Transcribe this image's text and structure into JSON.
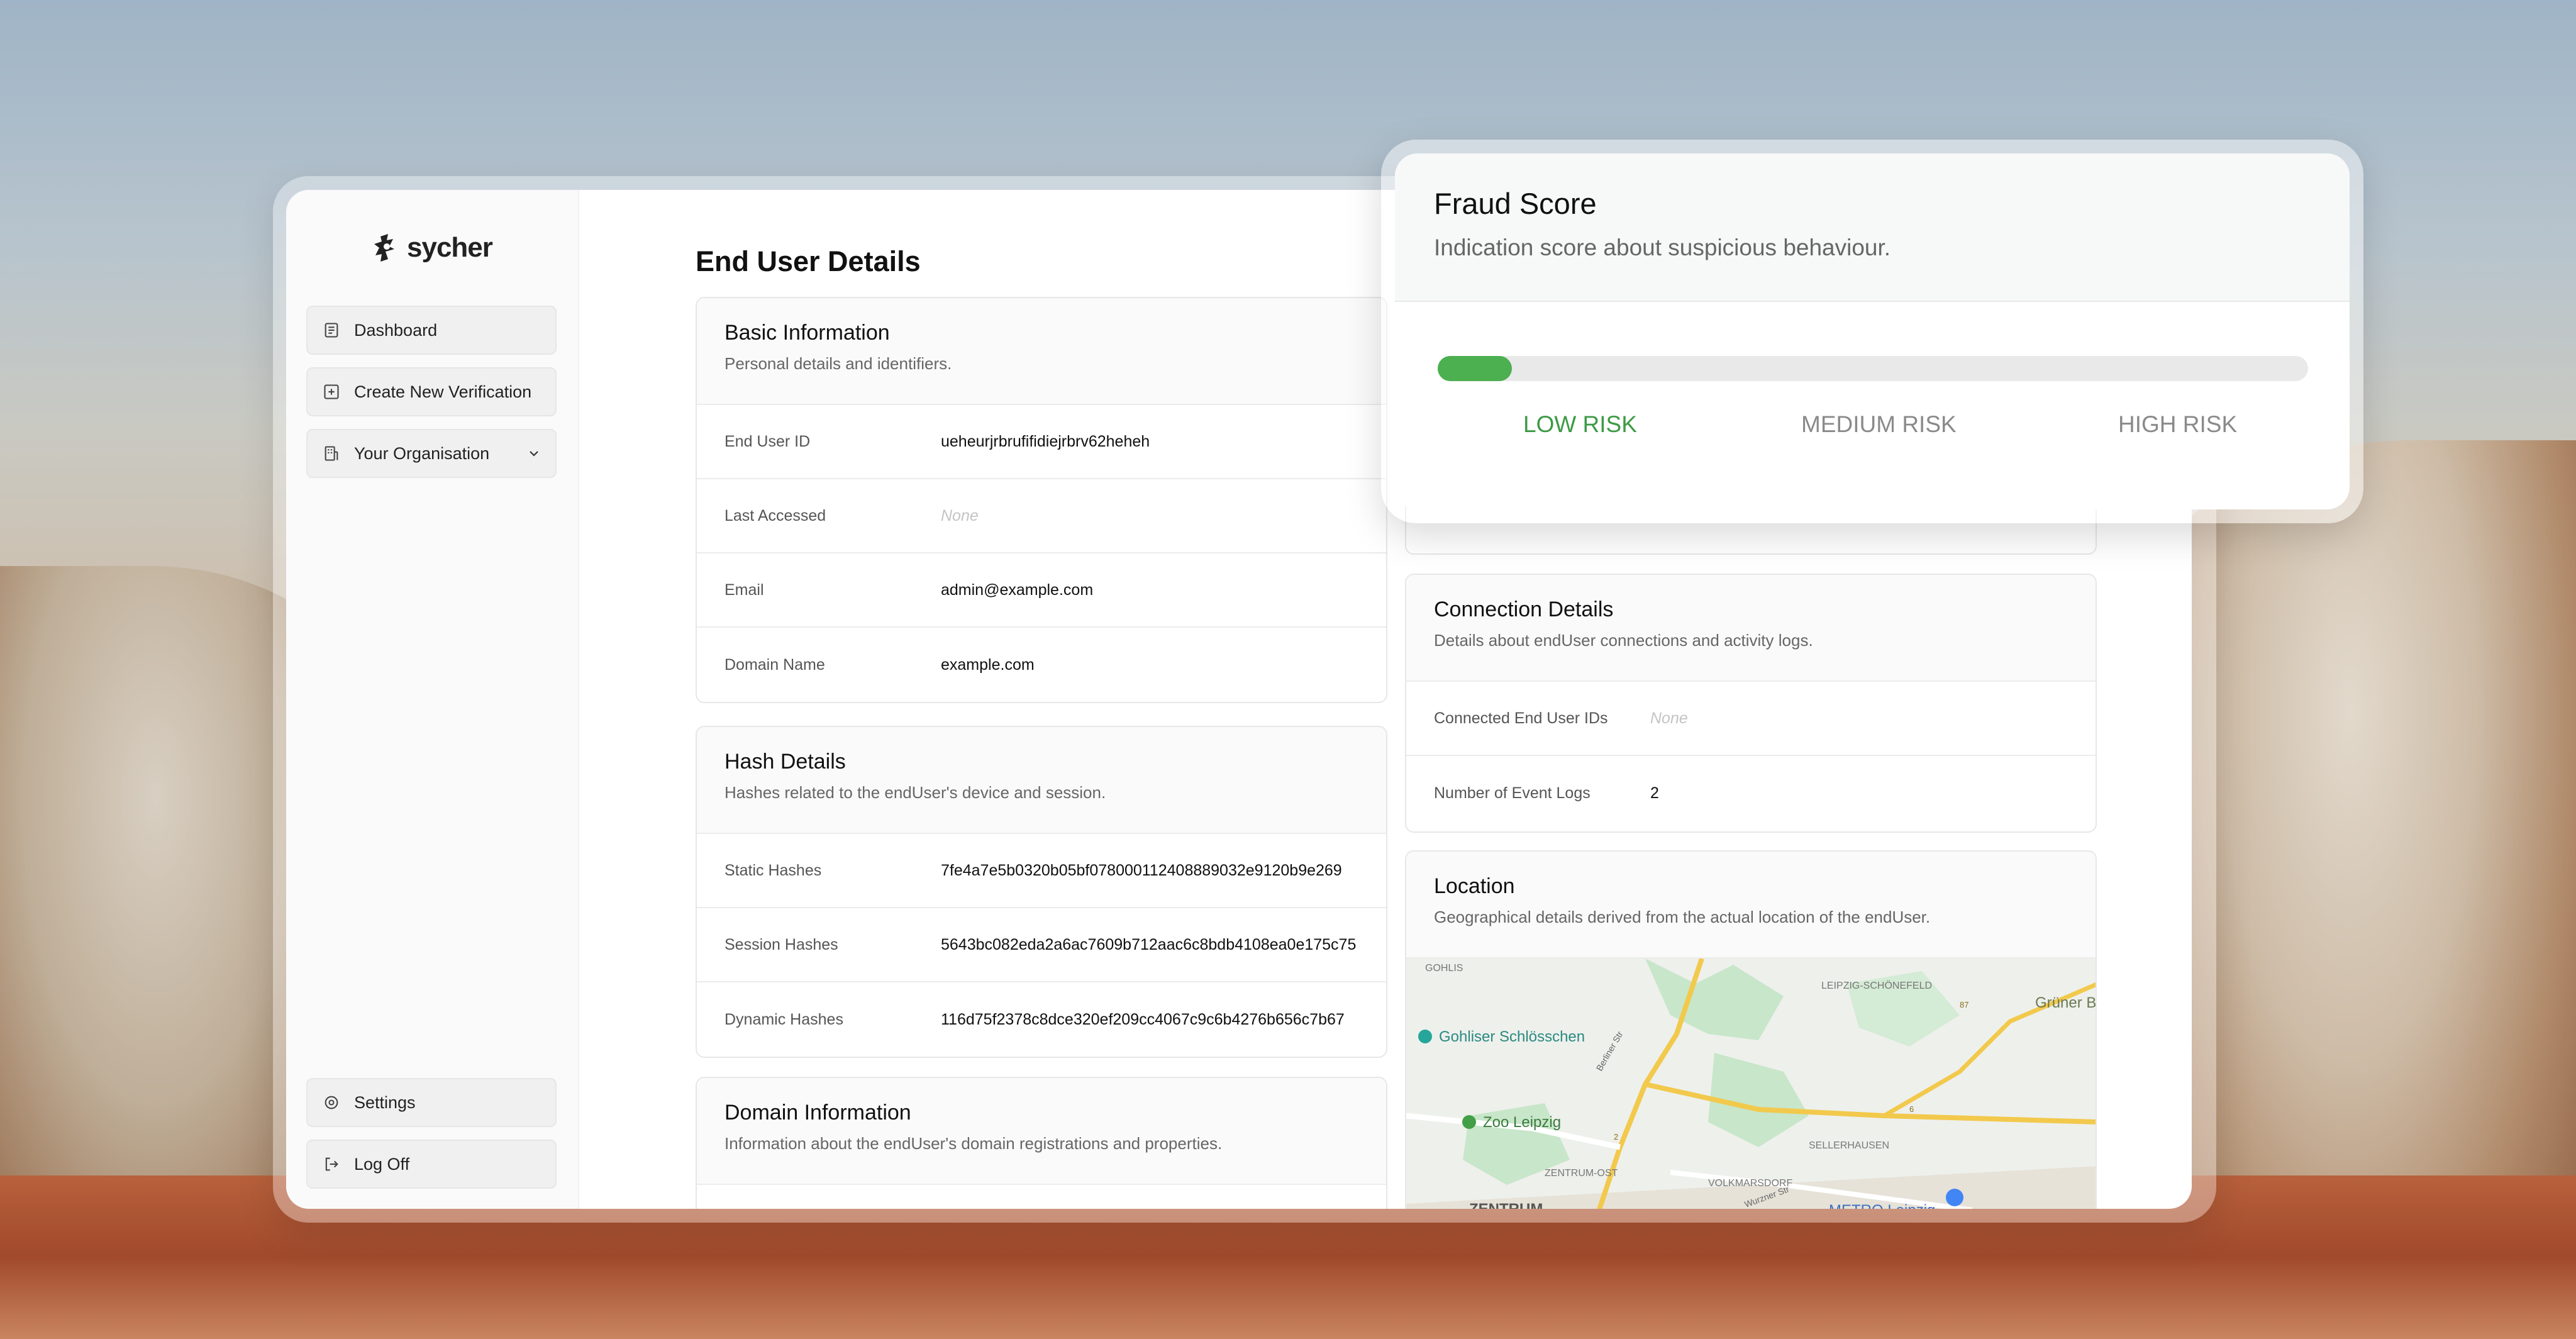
{
  "app": {
    "logo_text": "sycher"
  },
  "sidebar": {
    "items": [
      {
        "label": "Dashboard"
      },
      {
        "label": "Create New Verification"
      },
      {
        "label": "Your Organisation"
      }
    ],
    "bottom": [
      {
        "label": "Settings"
      },
      {
        "label": "Log Off"
      }
    ]
  },
  "page": {
    "title": "End User Details"
  },
  "basic_info": {
    "title": "Basic Information",
    "subtitle": "Personal details and identifiers.",
    "rows": [
      {
        "label": "End User ID",
        "value": "ueheurjrbrufifidiejrbrv62heheh"
      },
      {
        "label": "Last Accessed",
        "value": "None"
      },
      {
        "label": "Email",
        "value": "admin@example.com"
      },
      {
        "label": "Domain Name",
        "value": "example.com"
      }
    ]
  },
  "hash_details": {
    "title": "Hash Details",
    "subtitle": "Hashes related to the endUser's device and session.",
    "rows": [
      {
        "label": "Static Hashes",
        "value": "7fe4a7e5b0320b05bf0780001124088890​32e9120b9e269"
      },
      {
        "label": "Session Hashes",
        "value": "5643bc082eda2a6ac7609b712aac6c8bdb4108ea0e175c75"
      },
      {
        "label": "Dynamic Hashes",
        "value": "116d75f2378c8dce320ef209cc4067c9c6b4276b656c7b67"
      }
    ]
  },
  "domain_info": {
    "title": "Domain Information",
    "subtitle": "Information about the endUser's domain registrations and properties."
  },
  "connection_details": {
    "title": "Connection Details",
    "subtitle": "Details about endUser connections and activity logs.",
    "rows": [
      {
        "label": "Connected End User IDs",
        "value": "None"
      },
      {
        "label": "Number of Event Logs",
        "value": "2"
      }
    ]
  },
  "location": {
    "title": "Location",
    "subtitle": "Geographical details derived from the actual location of the endUser.",
    "map_labels": {
      "gohlis": "GOHLIS",
      "schonefeld": "LEIPZIG-SCHÖNEFELD",
      "gruner_bogen": "Grüner Bog",
      "schlosschen": "Gohliser Schlösschen",
      "zoo": "Zoo Leipzig",
      "sellerhausen": "SELLERHAUSEN",
      "zentrum_ost": "ZENTRUM-OST",
      "volkmarsdorf": "VOLKMARSDORF",
      "zentrum": "ZENTRUM",
      "metro": "METRO Leipzig",
      "berliner_str": "Berliner Str",
      "wurzner_str": "Wurzner Str",
      "road_87": "87",
      "road_6": "6",
      "road_2": "2"
    }
  },
  "fraud_score": {
    "title": "Fraud Score",
    "subtitle": "Indication score about suspicious behaviour.",
    "level": 0.085,
    "labels": {
      "low": "LOW RISK",
      "medium": "MEDIUM RISK",
      "high": "HIGH RISK"
    },
    "colors": {
      "low": "#3d9a45",
      "inactive": "#8a8a8a",
      "fill": "#4caf50"
    }
  }
}
